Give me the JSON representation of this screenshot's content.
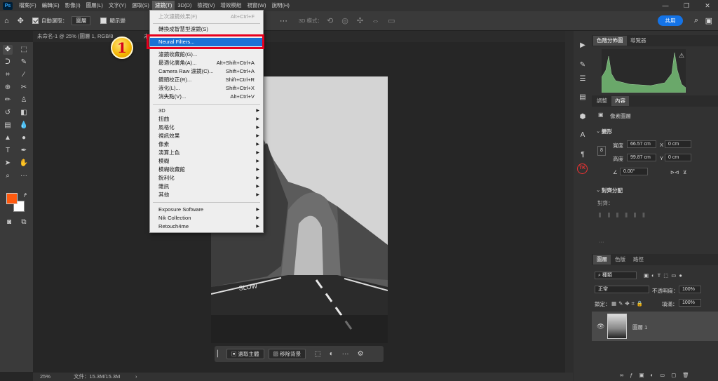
{
  "menubar": {
    "items": [
      "檔案(F)",
      "編輯(E)",
      "影像(I)",
      "圖層(L)",
      "文字(Y)",
      "選取(S)",
      "濾鏡(T)",
      "3D(D)",
      "檢視(V)",
      "增效模組",
      "視窗(W)",
      "說明(H)"
    ],
    "active_index": 6
  },
  "options": {
    "auto_select_label": "自動選取：",
    "auto_select_value": "圖層",
    "show_transform_label": "顯示變",
    "mode_3d_label": "3D 模式：",
    "share_label": "共用"
  },
  "document": {
    "tab_title": "未命名-1 @ 25% (圖層 1, RGB/8",
    "tab_extra": "未"
  },
  "dropdown": {
    "items": [
      {
        "label": "上次濾鏡效果(F)",
        "shortcut": "Alt+Ctrl+F",
        "disabled": true
      },
      {
        "label": "轉換成智慧型濾鏡(S)",
        "shortcut": ""
      },
      {
        "label": "Neural Filters...",
        "shortcut": "",
        "highlighted": true
      },
      {
        "label": "濾鏡收藏館(G)...",
        "shortcut": ""
      },
      {
        "label": "最適化廣角(A)...",
        "shortcut": "Alt+Shift+Ctrl+A"
      },
      {
        "label": "Camera Raw 濾鏡(C)...",
        "shortcut": "Shift+Ctrl+A"
      },
      {
        "label": "鏡頭校正(R)...",
        "shortcut": "Shift+Ctrl+R"
      },
      {
        "label": "液化(L)...",
        "shortcut": "Shift+Ctrl+X"
      },
      {
        "label": "消失點(V)...",
        "shortcut": "Alt+Ctrl+V"
      },
      {
        "label": "3D",
        "shortcut": "",
        "submenu": true
      },
      {
        "label": "扭曲",
        "shortcut": "",
        "submenu": true
      },
      {
        "label": "風格化",
        "shortcut": "",
        "submenu": true
      },
      {
        "label": "視訊效果",
        "shortcut": "",
        "submenu": true
      },
      {
        "label": "像素",
        "shortcut": "",
        "submenu": true
      },
      {
        "label": "演算上色",
        "shortcut": "",
        "submenu": true
      },
      {
        "label": "模糊",
        "shortcut": "",
        "submenu": true
      },
      {
        "label": "模糊收藏館",
        "shortcut": "",
        "submenu": true
      },
      {
        "label": "銳利化",
        "shortcut": "",
        "submenu": true
      },
      {
        "label": "雜訊",
        "shortcut": "",
        "submenu": true
      },
      {
        "label": "其他",
        "shortcut": "",
        "submenu": true
      },
      {
        "label": "Exposure Software",
        "shortcut": "",
        "submenu": true
      },
      {
        "label": "Nik Collection",
        "shortcut": "",
        "submenu": true
      },
      {
        "label": "Retouch4me",
        "shortcut": "",
        "submenu": true
      }
    ]
  },
  "badge": {
    "number": "1"
  },
  "contextbar": {
    "select_subject": "選取主體",
    "remove_bg": "移除背景"
  },
  "histogram": {
    "tab_histogram": "色階分佈圖",
    "tab_navigator": "導覽器"
  },
  "properties": {
    "tab_adjust": "調整",
    "tab_props": "內容",
    "layer_kind": "像素圖層",
    "transform_title": "變形",
    "w_label": "寬度",
    "w_value": "66.57 cm",
    "x_label": "X",
    "x_value": "0 cm",
    "h_label": "高度",
    "h_value": "99.87 cm",
    "y_label": "Y",
    "y_value": "0 cm",
    "angle_value": "0.00°",
    "align_title": "對齊分配",
    "align_label": "對齊："
  },
  "layers": {
    "tab_layers": "圖層",
    "tab_channels": "色版",
    "tab_paths": "路徑",
    "kind_label": "種類",
    "blend_mode": "正常",
    "opacity_label": "不透明度：",
    "opacity_value": "100%",
    "lock_label": "鎖定：",
    "fill_label": "填滿：",
    "fill_value": "100%",
    "layer_name": "圖層 1"
  },
  "status": {
    "zoom": "25%",
    "doc_size": "文件：15.3M/15.3M"
  },
  "colors": {
    "foreground": "#ff5a0f",
    "background": "#ffffff",
    "highlight": "#1a71d6",
    "redbox": "#e8001e"
  }
}
